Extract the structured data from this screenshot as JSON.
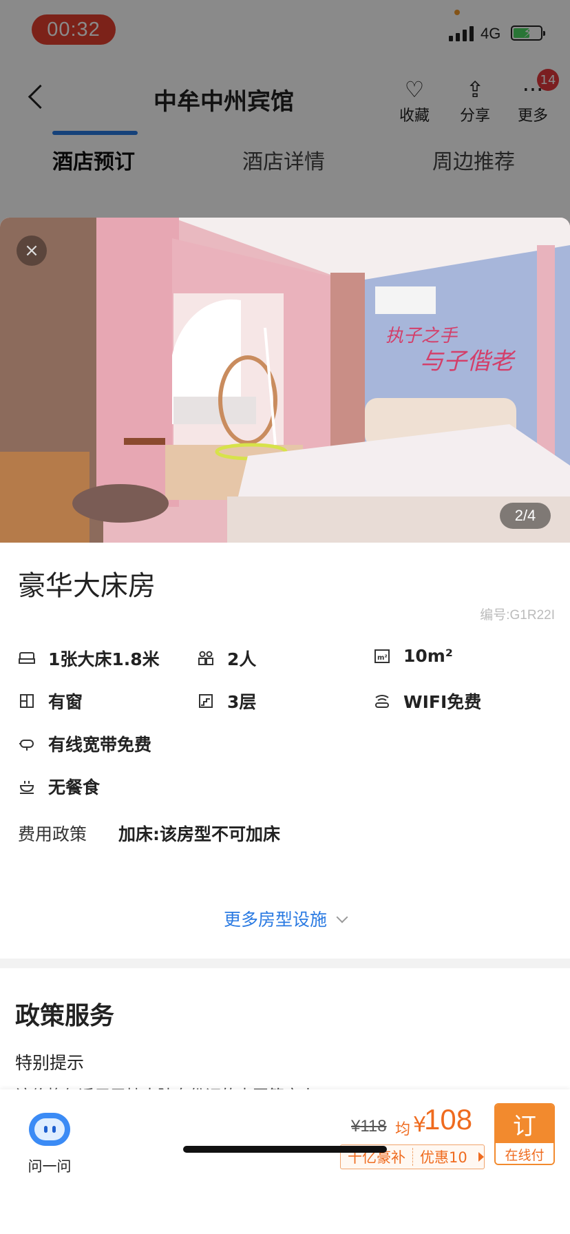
{
  "status_bar": {
    "time": "00:32",
    "network": "4G"
  },
  "header": {
    "title": "中牟中州宾馆",
    "actions": {
      "favorite": "收藏",
      "share": "分享",
      "more": "更多"
    },
    "more_badge": "14"
  },
  "tabs": [
    {
      "label": "酒店预订",
      "active": true
    },
    {
      "label": "酒店详情",
      "active": false
    },
    {
      "label": "周边推荐",
      "active": false
    }
  ],
  "room": {
    "photo_counter": "2/4",
    "name": "豪华大床房",
    "code": "编号:G1R22I",
    "facilities": {
      "bed": "1张大床1.8米",
      "guests": "2人",
      "area": "10m²",
      "window": "有窗",
      "floor": "3层",
      "wifi": "WIFI免费",
      "broadband": "有线宽带免费",
      "meal": "无餐食"
    },
    "fee_policy_label": "费用政策",
    "fee_policy_value": "加床:该房型不可加床",
    "more_facilities": "更多房型设施"
  },
  "policy": {
    "title": "政策服务",
    "special_label": "特别提示",
    "special_text": "该价格仅适用于持大陆身份证的中国籍客人"
  },
  "bottom_bar": {
    "ask_label": "问一问",
    "old_price": "¥118",
    "avg_label": "均",
    "currency": "¥",
    "price": "108",
    "promo_tag": "十亿豪补",
    "promo_discount": "优惠10",
    "book_label": "订",
    "pay_label": "在线付"
  },
  "colors": {
    "accent_blue": "#2a7ae2",
    "price_orange": "#ef6b1f",
    "book_orange": "#f28a2e",
    "time_pill_red": "#e5402f"
  }
}
